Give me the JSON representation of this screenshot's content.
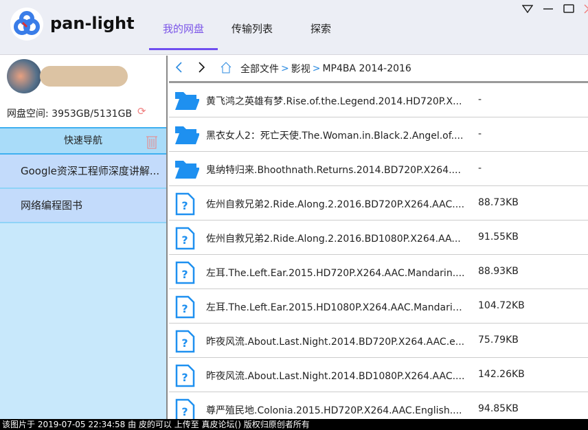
{
  "app": {
    "name": "pan-light"
  },
  "tabs": [
    {
      "label": "我的网盘"
    },
    {
      "label": "传输列表"
    },
    {
      "label": "探索"
    }
  ],
  "user": {
    "quota_label": "网盘空间: 3953GB/5131GB"
  },
  "quicknav": {
    "title": "快速导航",
    "items": [
      {
        "label": "Google资深工程师深度讲解..."
      },
      {
        "label": "网络编程图书"
      }
    ]
  },
  "breadcrumb": [
    "全部文件",
    "影视",
    "MP4BA 2014-2016"
  ],
  "files": [
    {
      "type": "folder",
      "name": "黄飞鸿之英雄有梦.Rise.of.the.Legend.2014.HD720P.X...",
      "size": "-"
    },
    {
      "type": "folder",
      "name": "黑衣女人2：死亡天使.The.Woman.in.Black.2.Angel.of....",
      "size": "-"
    },
    {
      "type": "folder",
      "name": "鬼纳特归来.Bhoothnath.Returns.2014.BD720P.X264....",
      "size": "-"
    },
    {
      "type": "file",
      "name": "佐州自救兄弟2.Ride.Along.2.2016.BD720P.X264.AAC....",
      "size": "88.73KB"
    },
    {
      "type": "file",
      "name": "佐州自救兄弟2.Ride.Along.2.2016.BD1080P.X264.AA...",
      "size": "91.55KB"
    },
    {
      "type": "file",
      "name": "左耳.The.Left.Ear.2015.HD720P.X264.AAC.Mandarin....",
      "size": "88.93KB"
    },
    {
      "type": "file",
      "name": "左耳.The.Left.Ear.2015.HD1080P.X264.AAC.Mandarin...",
      "size": "104.72KB"
    },
    {
      "type": "file",
      "name": "昨夜风流.About.Last.Night.2014.BD720P.X264.AAC.e...",
      "size": "75.79KB"
    },
    {
      "type": "file",
      "name": "昨夜风流.About.Last.Night.2014.BD1080P.X264.AAC....",
      "size": "142.26KB"
    },
    {
      "type": "file",
      "name": "尊严殖民地.Colonia.2015.HD720P.X264.AAC.English....",
      "size": "94.85KB"
    }
  ],
  "status_bar": "该图片于 2019-07-05 22:34:58 由 皮的可以 上传至 真皮论坛() 版权归原创者所有",
  "colors": {
    "accent": "#6f4ef0",
    "folder": "#1e90f0",
    "sidebar": "#c8e8fb"
  }
}
